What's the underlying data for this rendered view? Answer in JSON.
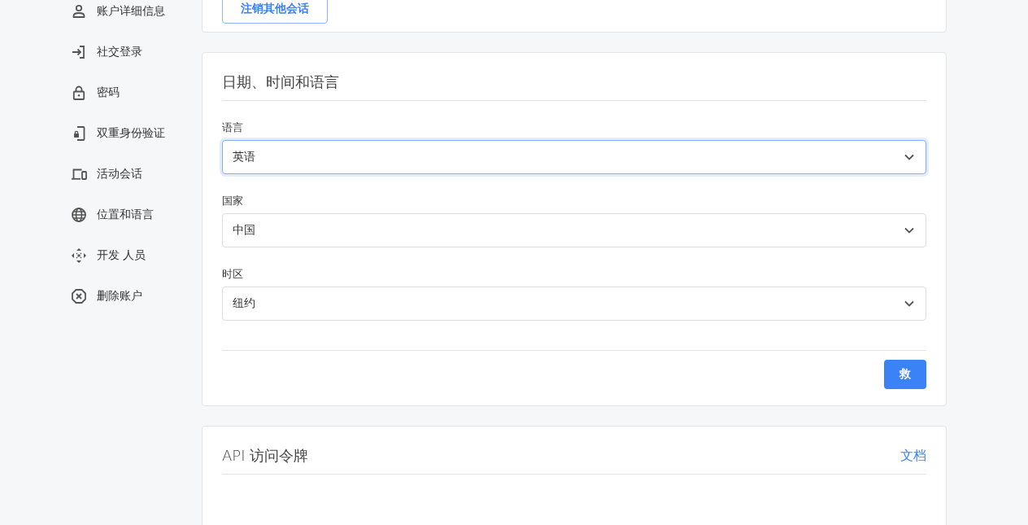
{
  "sidebar": {
    "items": [
      {
        "label": "账户详细信息"
      },
      {
        "label": "社交登录"
      },
      {
        "label": "密码"
      },
      {
        "label": "双重身份验证"
      },
      {
        "label": "活动会话"
      },
      {
        "label": "位置和语言"
      },
      {
        "label": "开发 人员"
      },
      {
        "label": "删除账户"
      }
    ]
  },
  "sessions_card": {
    "button": "注销其他会话"
  },
  "locale_card": {
    "title": "日期、时间和语言",
    "fields": [
      {
        "label": "语言",
        "value": "英语",
        "focused": true
      },
      {
        "label": "国家",
        "value": "中国",
        "focused": false
      },
      {
        "label": "时区",
        "value": "纽约",
        "focused": false
      }
    ],
    "button": "救"
  },
  "api_card": {
    "title": "API 访问令牌",
    "link": "文档"
  }
}
